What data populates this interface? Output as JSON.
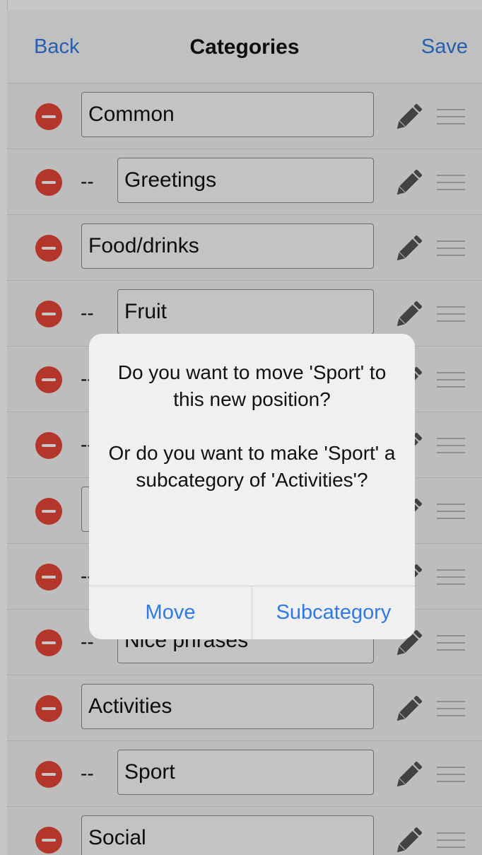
{
  "navbar": {
    "back_label": "Back",
    "title": "Categories",
    "save_label": "Save"
  },
  "rows": [
    {
      "level": 0,
      "dash": "",
      "value": "Common"
    },
    {
      "level": 1,
      "dash": "--",
      "value": "Greetings"
    },
    {
      "level": 0,
      "dash": "",
      "value": "Food/drinks"
    },
    {
      "level": 1,
      "dash": "--",
      "value": "Fruit"
    },
    {
      "level": 1,
      "dash": "--",
      "value": ""
    },
    {
      "level": 1,
      "dash": "--",
      "value": ""
    },
    {
      "level": 0,
      "dash": "",
      "value": ""
    },
    {
      "level": 1,
      "dash": "--",
      "value": ""
    },
    {
      "level": 1,
      "dash": "--",
      "value": "Nice phrases"
    },
    {
      "level": 0,
      "dash": "",
      "value": "Activities"
    },
    {
      "level": 1,
      "dash": "--",
      "value": "Sport"
    },
    {
      "level": 0,
      "dash": "",
      "value": "Social"
    }
  ],
  "icons": {
    "delete": "minus-circle-icon",
    "edit": "pencil-icon",
    "reorder": "drag-handle-icon"
  },
  "colors": {
    "accent": "#2f7ae5",
    "delete": "#e74535"
  },
  "alert": {
    "message_1": "Do you want to move 'Sport' to this new position?",
    "message_2": "Or do you want to make 'Sport' a subcategory of 'Activities'?",
    "move_label": "Move",
    "subcategory_label": "Subcategory"
  }
}
